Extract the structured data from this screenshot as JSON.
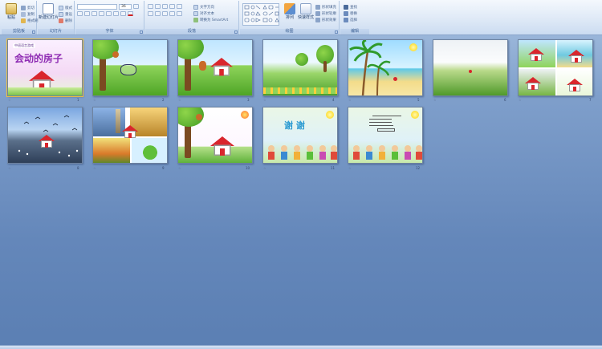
{
  "ribbon": {
    "clipboard": {
      "label": "剪贴板",
      "paste": "粘贴",
      "cut": "剪切",
      "copy": "复制",
      "format_painter": "格式刷"
    },
    "slides": {
      "label": "幻灯片",
      "new_slide": "新建幻灯片",
      "layout": "版式",
      "reset": "重设",
      "delete": "删除"
    },
    "font": {
      "label": "字体",
      "font_size": "36"
    },
    "paragraph": {
      "label": "段落",
      "text_direction": "文字方向",
      "align_text": "对齐文本",
      "smartart": "转换为 SmartArt"
    },
    "drawing": {
      "label": "绘图",
      "arrange": "排列",
      "quick_styles": "快速样式",
      "shape_fill": "形状填充",
      "shape_outline": "形状轮廓",
      "shape_effects": "形状效果"
    },
    "editing": {
      "label": "编辑",
      "find": "查找",
      "replace": "替换",
      "select": "选择"
    }
  },
  "slides": [
    {
      "number": "1",
      "title_banner": "中班语言游戏",
      "title": "会动的房子"
    },
    {
      "number": "2"
    },
    {
      "number": "3"
    },
    {
      "number": "4"
    },
    {
      "number": "5"
    },
    {
      "number": "6"
    },
    {
      "number": "7"
    },
    {
      "number": "8"
    },
    {
      "number": "9"
    },
    {
      "number": "10"
    },
    {
      "number": "11",
      "title": "谢 谢"
    },
    {
      "number": "12"
    }
  ],
  "colors": {
    "accent": "#15428b",
    "ribbon_bg": "#dde8f6",
    "workspace": "#6487ba"
  }
}
